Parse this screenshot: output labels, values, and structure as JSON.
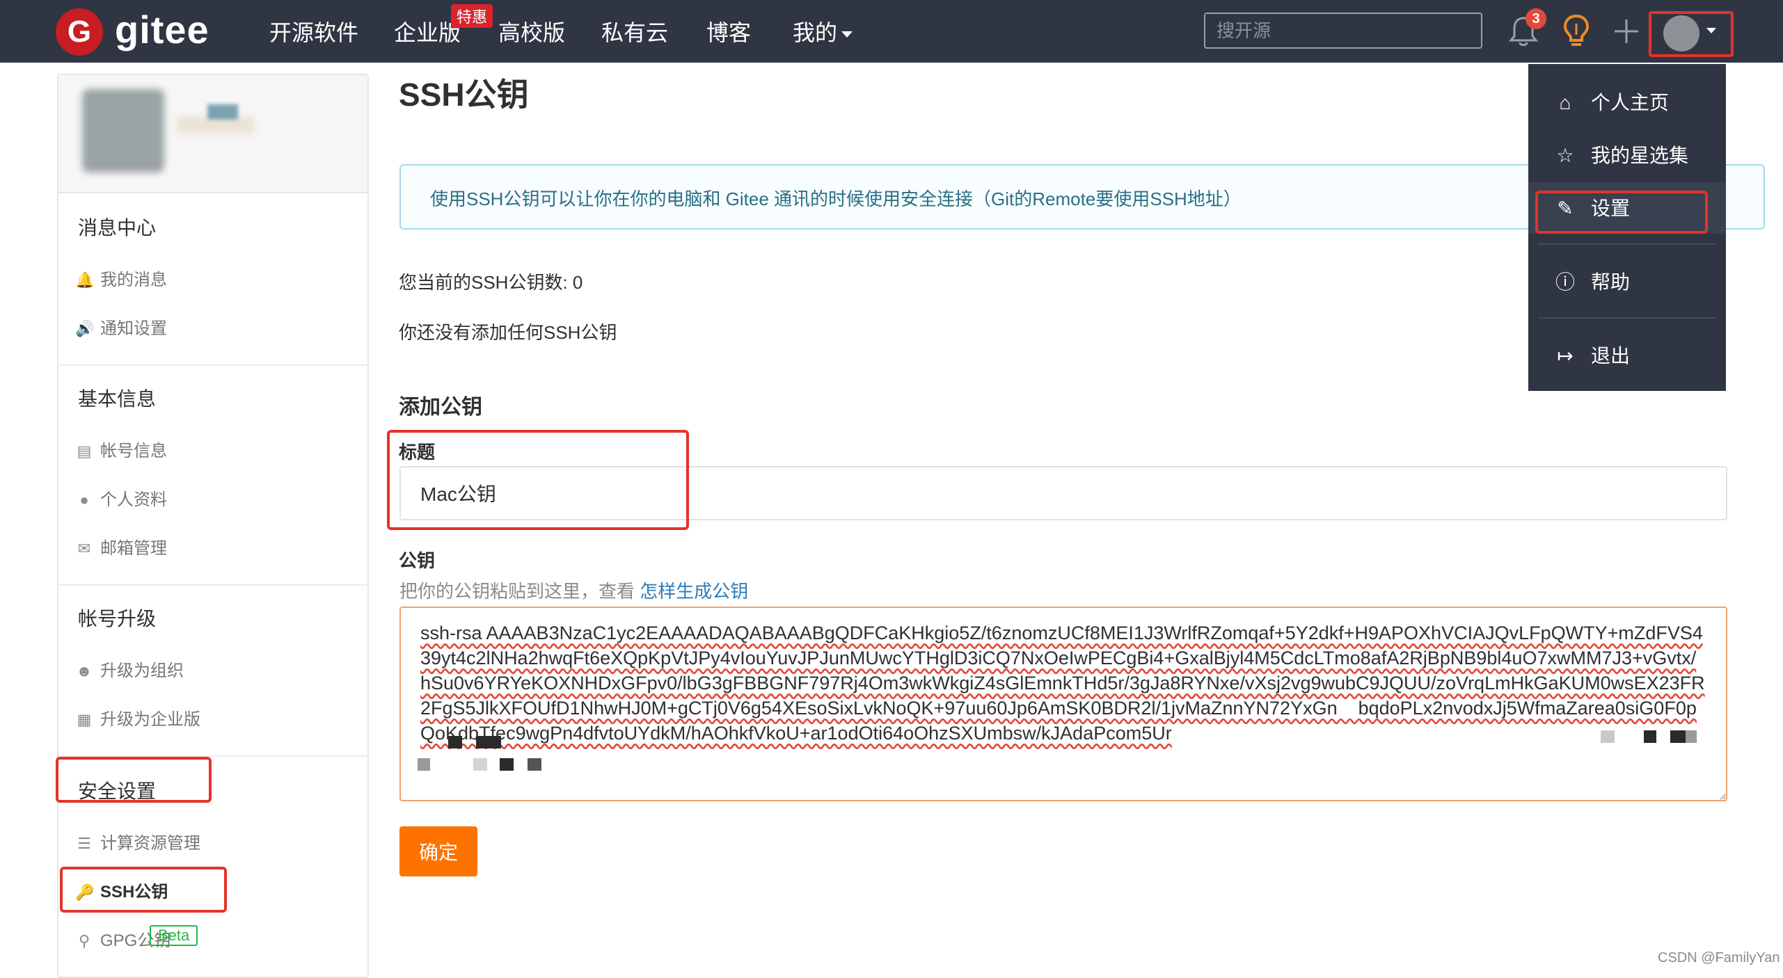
{
  "topbar": {
    "logo_letter": "G",
    "logo_text": "gitee",
    "nav": [
      "开源软件",
      "企业版",
      "高校版",
      "私有云",
      "博客",
      "我的"
    ],
    "hot_badge": "特惠",
    "search_placeholder": "搜开源",
    "notification_count": "3",
    "plus_icon": "+"
  },
  "sidebar": {
    "sections": [
      {
        "title": "消息中心",
        "items": [
          {
            "icon": "bell-icon",
            "label": "我的消息"
          },
          {
            "icon": "speaker-icon",
            "label": "通知设置"
          }
        ]
      },
      {
        "title": "基本信息",
        "items": [
          {
            "icon": "id-card-icon",
            "label": "帐号信息"
          },
          {
            "icon": "user-icon",
            "label": "个人资料"
          },
          {
            "icon": "mail-icon",
            "label": "邮箱管理"
          }
        ]
      },
      {
        "title": "帐号升级",
        "items": [
          {
            "icon": "users-icon",
            "label": "升级为组织"
          },
          {
            "icon": "building-icon",
            "label": "升级为企业版"
          }
        ]
      },
      {
        "title": "安全设置",
        "items": [
          {
            "icon": "server-icon",
            "label": "计算资源管理"
          },
          {
            "icon": "key-icon",
            "label": "SSH公钥"
          },
          {
            "icon": "gpg-key-icon",
            "label": "GPG公钥"
          }
        ]
      }
    ],
    "beta_badge": "Beta"
  },
  "main": {
    "title": "SSH公钥",
    "info": "使用SSH公钥可以让你在你的电脑和 Gitee 通讯的时候使用安全连接（Git的Remote要使用SSH地址）",
    "key_count_text": "您当前的SSH公钥数: 0",
    "no_key_text": "你还没有添加任何SSH公钥",
    "add_title": "添加公钥",
    "title_label": "标题",
    "title_value": "Mac公钥",
    "key_label": "公钥",
    "key_hint": "把你的公钥粘贴到这里，查看 ",
    "key_hint_link": "怎样生成公钥",
    "key_value": "ssh-rsa AAAAB3NzaC1yc2EAAAADAQABAAABgQDFCaKHkgio5Z/t6znomzUCf8MEI1J3WrlfRZomqaf+5Y2dkf+H9APOXhVCIAJQvLFpQWTY+mZdFVS439yt4c2lNHa2hwqFt6eXQpKpVtJPy4vIouYuvJPJunMUwcYTHglD3iCQ7NxOeIwPECgBi4+GxalBjyl4M5CdcLTmo8afA2RjBpNB9bl4uO7xwMM7J3+vGvtx/hSu0v6YRYeKOXNHDxGFpv0/lbG3gFBBGNF797Rj4Om3wkWkgiZ4sGlEmnkTHd5r/3gJa8RYNxe/vXsj2vg9wubC9JQUU/zoVrqLmHkGaKUM0wsEX23FR2FgS5JlkXFOUfD1NhwHJ0M+gCTj0V6g54XEsoSixLvkNoQK+97uu60Jp6AmSK0BDR2l/1jvMaZnnYN72YxGn    bqdoPLx2nvodxJj5WfmaZarea0siG0F0pQoKdbTfec9wgPn4dfvtoUYdkM/hAOhkfVkoU+ar1odOti64oOhzSXUmbsw/kJAdaPcom5Ur",
    "submit_label": "确定"
  },
  "dropdown": {
    "items": [
      {
        "icon": "home-icon",
        "label": "个人主页"
      },
      {
        "icon": "star-icon",
        "label": "我的星选集"
      },
      {
        "icon": "edit-icon",
        "label": "设置"
      },
      {
        "icon": "help-icon",
        "label": "帮助"
      },
      {
        "icon": "logout-icon",
        "label": "退出"
      }
    ]
  },
  "watermark": "CSDN @FamilyYan"
}
